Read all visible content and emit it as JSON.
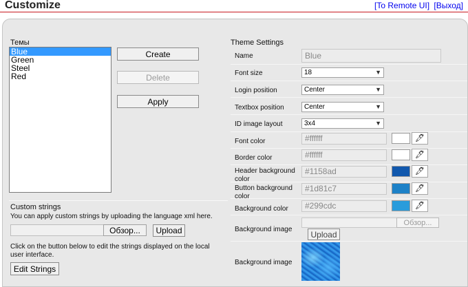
{
  "header": {
    "title": "Customize",
    "link_remote": "[To Remote UI]",
    "link_exit": "[Выход]"
  },
  "themes": {
    "label": "Темы",
    "items": [
      "Blue",
      "Green",
      "Steel",
      "Red"
    ],
    "selected": "Blue",
    "create_label": "Create",
    "delete_label": "Delete",
    "apply_label": "Apply"
  },
  "custom_strings": {
    "heading": "Custom strings",
    "description": "You can apply custom strings by uploading the language xml here.",
    "file_value": "",
    "browse_label": "Обзор...",
    "upload_label": "Upload",
    "edit_description": "Click on the button below to edit the strings displayed on the local user interface.",
    "edit_label": "Edit Strings"
  },
  "theme_settings": {
    "heading": "Theme Settings",
    "name_label": "Name",
    "name_value": "Blue",
    "font_size_label": "Font size",
    "font_size_value": "18",
    "login_position_label": "Login position",
    "login_position_value": "Center",
    "textbox_position_label": "Textbox position",
    "textbox_position_value": "Center",
    "id_image_layout_label": "ID image layout",
    "id_image_layout_value": "3x4",
    "font_color_label": "Font color",
    "font_color_value": "#ffffff",
    "border_color_label": "Border color",
    "border_color_value": "#ffffff",
    "header_bg_label": "Header background color",
    "header_bg_value": "#1158ad",
    "button_bg_label": "Button background color",
    "button_bg_value": "#1d81c7",
    "bg_color_label": "Background color",
    "bg_color_value": "#299cdc",
    "bg_image_label": "Background image",
    "bg_image_file_value": "",
    "bg_image_browse_label": "Обзор...",
    "bg_image_upload_label": "Upload",
    "bg_image_preview_label": "Background image"
  },
  "colors": {
    "accent_red": "#c8161d",
    "selection": "#3399ff",
    "link": "#0000ee"
  }
}
